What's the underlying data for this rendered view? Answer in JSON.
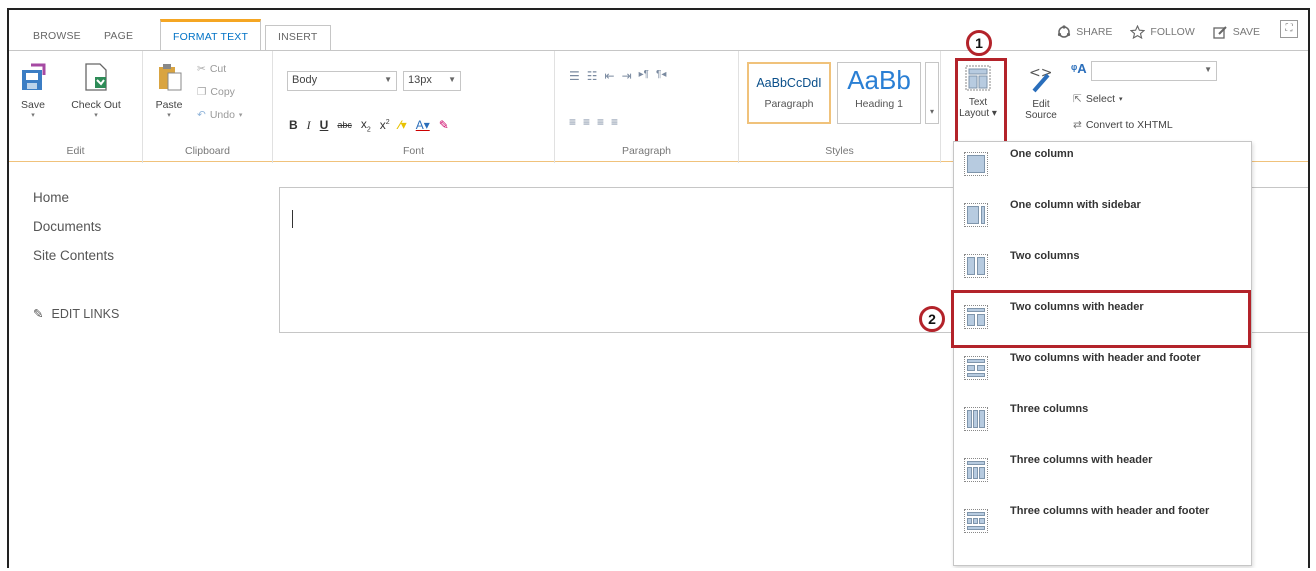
{
  "tabs": [
    {
      "label": "BROWSE"
    },
    {
      "label": "PAGE"
    },
    {
      "label": "FORMAT TEXT",
      "active": true
    },
    {
      "label": "INSERT"
    }
  ],
  "top_actions": {
    "share": "SHARE",
    "follow": "FOLLOW",
    "save": "SAVE"
  },
  "ribbon": {
    "edit": {
      "save": "Save",
      "check_out": "Check Out",
      "label": "Edit"
    },
    "clipboard": {
      "paste": "Paste",
      "cut": "Cut",
      "copy": "Copy",
      "undo": "Undo",
      "label": "Clipboard"
    },
    "font": {
      "style_value": "Body",
      "size_value": "13px",
      "label": "Font"
    },
    "paragraph": {
      "label": "Paragraph"
    },
    "styles": {
      "paragraph_preview": "AaBbCcDdI",
      "paragraph_label": "Paragraph",
      "heading_preview": "AaBb",
      "heading_label": "Heading 1",
      "label": "Styles"
    },
    "layout": {
      "text_layout_line1": "Text",
      "text_layout_line2": "Layout"
    },
    "markup": {
      "edit_line1": "Edit",
      "edit_line2": "Source",
      "select": "Select",
      "convert": "Convert to XHTML"
    }
  },
  "left_nav": [
    "Home",
    "Documents",
    "Site Contents"
  ],
  "edit_links": "EDIT LINKS",
  "markers": {
    "one": "1",
    "two": "2"
  },
  "layout_options": [
    "One column",
    "One column with sidebar",
    "Two columns",
    "Two columns with header",
    "Two columns with header and footer",
    "Three columns",
    "Three columns with header",
    "Three columns with header and footer"
  ],
  "colors": {
    "accent_blue": "#0072c6",
    "tab_orange": "#f5a623",
    "annotation_red": "#b3232a"
  }
}
